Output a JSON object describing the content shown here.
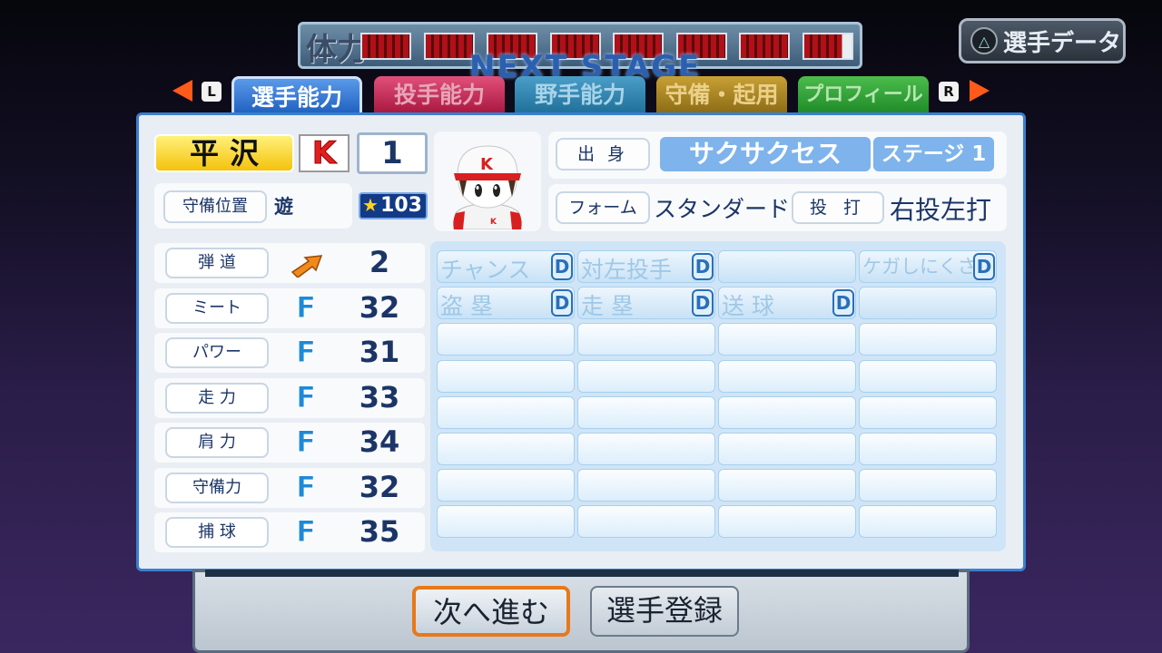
{
  "header": {
    "stamina_label": "体力",
    "stamina_segments": 8,
    "stamina_fill": 0.975,
    "stage_title": "NEXT STAGE",
    "player_data_button": "選手データ",
    "player_data_icon": "triangle-icon"
  },
  "tabs": {
    "left_key": "L",
    "right_key": "R",
    "items": [
      {
        "label": "選手能力",
        "active": true
      },
      {
        "label": "投手能力",
        "active": false
      },
      {
        "label": "野手能力",
        "active": false
      },
      {
        "label": "守備・起用",
        "active": false
      },
      {
        "label": "プロフィール",
        "active": false
      }
    ]
  },
  "player": {
    "name": "平沢",
    "team_logo": "K",
    "number": "1",
    "position_label": "守備位置",
    "position": "遊",
    "rating": "103",
    "origin_label": "出 身",
    "origin": "サクサクセス",
    "stage": "ステージ 1",
    "form_label": "フォーム",
    "form": "スタンダード 1",
    "bat_throw_label": "投 打",
    "bat_throw": "右投左打",
    "cap_letter": "K"
  },
  "stats": [
    {
      "label": "弾 道",
      "grade": "",
      "value": "2",
      "icon": "trajectory-arrow-icon"
    },
    {
      "label": "ミート",
      "grade": "F",
      "value": "32"
    },
    {
      "label": "パワー",
      "grade": "F",
      "value": "31"
    },
    {
      "label": "走 力",
      "grade": "F",
      "value": "33"
    },
    {
      "label": "肩 力",
      "grade": "F",
      "value": "34"
    },
    {
      "label": "守備力",
      "grade": "F",
      "value": "32"
    },
    {
      "label": "捕 球",
      "grade": "F",
      "value": "35"
    }
  ],
  "abilities": [
    [
      {
        "label": "チャンス",
        "grade": "D"
      },
      {
        "label": "対左投手",
        "grade": "D"
      },
      {
        "label": "",
        "grade": ""
      },
      {
        "label": "ケガしにくさ",
        "grade": "D"
      }
    ],
    [
      {
        "label": "盗 塁",
        "grade": "D"
      },
      {
        "label": "走 塁",
        "grade": "D"
      },
      {
        "label": "送 球",
        "grade": "D"
      },
      {
        "label": "",
        "grade": ""
      }
    ]
  ],
  "footer": {
    "next_button": "次へ進む",
    "register_button": "選手登録"
  }
}
